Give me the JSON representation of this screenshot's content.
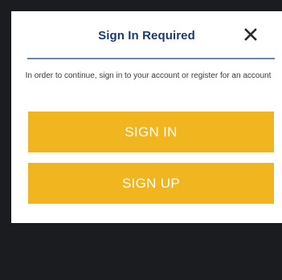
{
  "dialog": {
    "title": "Sign In Required",
    "message": "In order to continue, sign in to your account or register for an account",
    "close_icon": "close-icon"
  },
  "actions": {
    "sign_in_label": "SIGN IN",
    "sign_up_label": "SIGN UP"
  },
  "colors": {
    "backdrop": "#1b1c1f",
    "title": "#1f3a6b",
    "divider": "#6e86aa",
    "button": "#f1b51f",
    "button_text": "#ffffff"
  }
}
